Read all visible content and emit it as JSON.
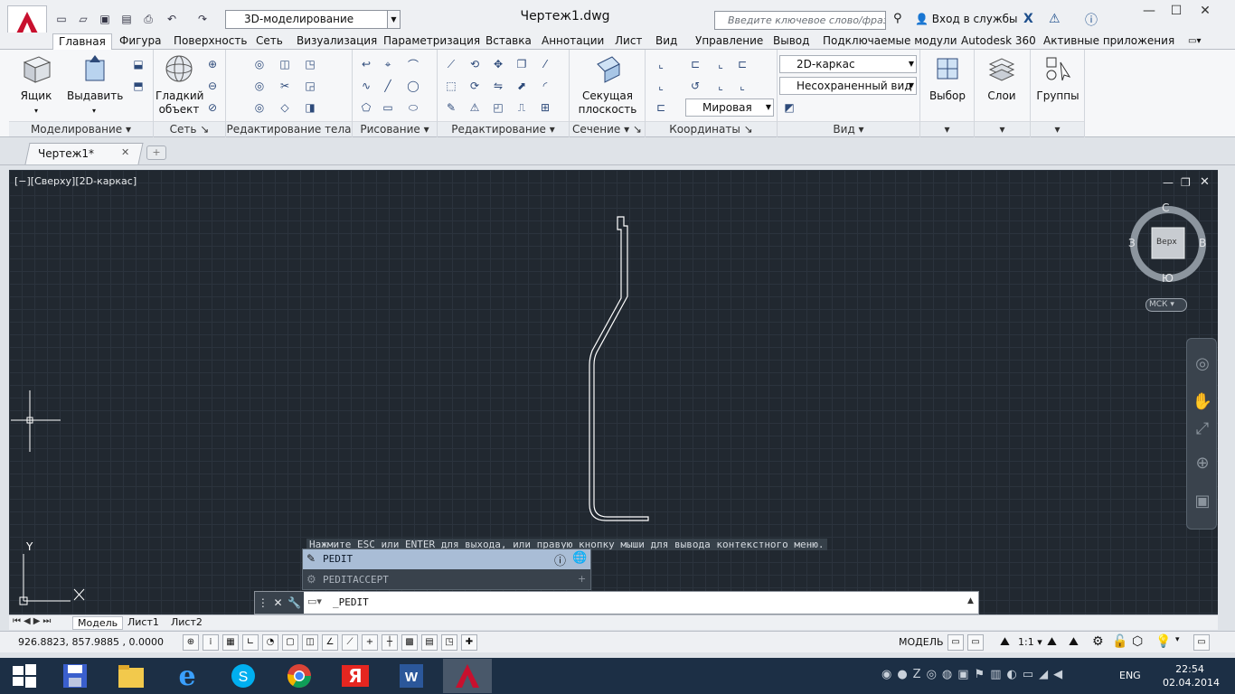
{
  "app": {
    "title": "Чертеж1.dwg",
    "workspace": "3D-моделирование"
  },
  "search": {
    "placeholder": "Введите ключевое слово/фразу"
  },
  "account": {
    "login": "Вход в службы"
  },
  "ribbon_tabs": [
    "Главная",
    "Фигура",
    "Поверхность",
    "Сеть",
    "Визуализация",
    "Параметризация",
    "Вставка",
    "Аннотации",
    "Лист",
    "Вид",
    "Управление",
    "Вывод",
    "Подключаемые модули",
    "Autodesk 360",
    "Активные приложения"
  ],
  "panels": {
    "modeling": {
      "title": "Моделирование",
      "box": "Ящик",
      "extrude": "Выдавить"
    },
    "mesh": {
      "title": "Сеть",
      "smooth": "Гладкий объект"
    },
    "solid_edit": {
      "title": "Редактирование тела"
    },
    "draw": {
      "title": "Рисование"
    },
    "modify": {
      "title": "Редактирование"
    },
    "section": {
      "title": "Сечение",
      "plane": "Секущая плоскость"
    },
    "coords": {
      "title": "Координаты",
      "world": "Мировая"
    },
    "view": {
      "title": "Вид",
      "visual_style": "2D-каркас",
      "named_view": "Несохраненный вид"
    },
    "select": {
      "label": "Выбор"
    },
    "layers": {
      "label": "Слои"
    },
    "groups": {
      "label": "Группы"
    }
  },
  "doc_tab": {
    "label": "Чертеж1*"
  },
  "viewport": {
    "label": "[−][Сверху][2D-каркас]"
  },
  "viewcube": {
    "north": "С",
    "south": "Ю",
    "west": "З",
    "east": "В",
    "face": "Верх",
    "ucs": "МСК"
  },
  "ucs_icon": {
    "y": "Y"
  },
  "command": {
    "hint": "Нажмите ESC или ENTER для выхода, или правую кнопку мыши для вывода контекстного меню.",
    "suggestion1": "PEDIT",
    "suggestion2": "PEDITACCEPT",
    "current": "_PEDIT"
  },
  "layout_tabs": [
    "Модель",
    "Лист1",
    "Лист2"
  ],
  "status": {
    "coords": "926.8823, 857.9885 , 0.0000",
    "model": "МОДЕЛЬ",
    "scale": "1:1"
  },
  "taskbar": {
    "apps": [
      "save-icon",
      "file-explorer-icon",
      "internet-explorer-icon",
      "skype-icon",
      "chrome-icon",
      "yandex-icon",
      "word-icon",
      "autocad-icon"
    ],
    "lang": "ENG",
    "time": "22:54",
    "date": "02.04.2014"
  },
  "colors": {
    "canvas": "#212830",
    "accent": "#c8102e",
    "line": "#ffffff"
  }
}
